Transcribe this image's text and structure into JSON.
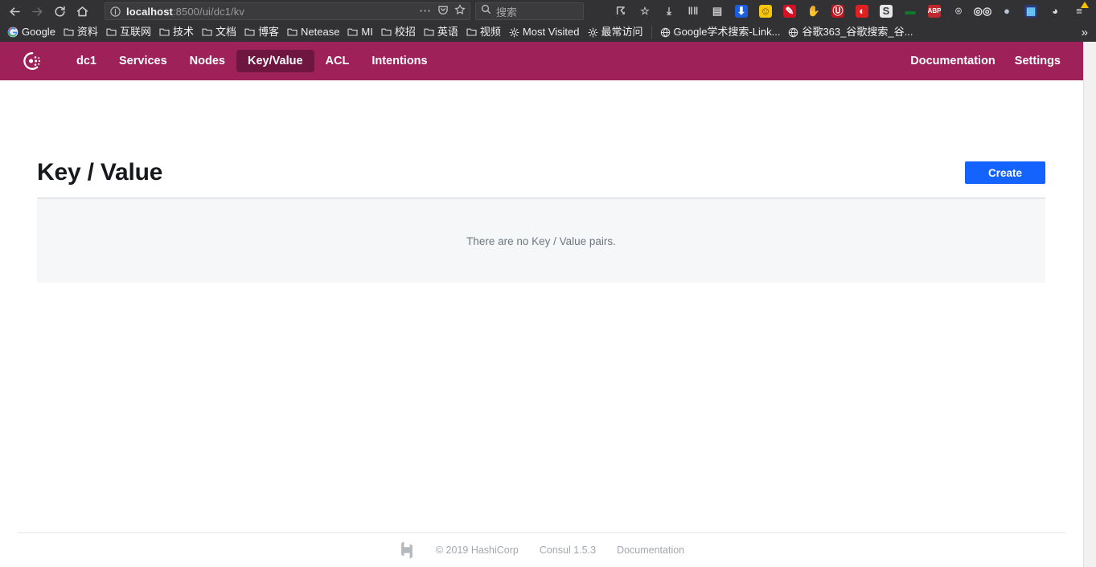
{
  "browser": {
    "nav_buttons": [
      {
        "name": "back-button",
        "icon": "arrow-left-icon",
        "enabled": true
      },
      {
        "name": "forward-button",
        "icon": "arrow-right-icon",
        "enabled": false
      },
      {
        "name": "reload-button",
        "icon": "reload-icon",
        "enabled": true
      },
      {
        "name": "home-button",
        "icon": "home-icon",
        "enabled": true
      }
    ],
    "url": {
      "host": "localhost",
      "path": ":8500/ui/dc1/kv",
      "full": "localhost:8500/ui/dc1/kv",
      "info_icon": "info-circle-icon",
      "page_actions_icon": "ellipsis-icon",
      "reader_icon": "pocket-icon",
      "bookmark_icon": "star-icon"
    },
    "search": {
      "placeholder": "搜索",
      "icon": "search-icon"
    },
    "extensions": [
      {
        "name": "pocket-save-icon",
        "glyph": "☈",
        "color": "#c9c9cb",
        "bg": "transparent"
      },
      {
        "name": "bookmark-star-icon",
        "glyph": "☆",
        "color": "#c9c9cb",
        "bg": "transparent"
      },
      {
        "name": "downloads-icon",
        "glyph": "⤓",
        "color": "#c9c9cb",
        "bg": "transparent"
      },
      {
        "name": "library-icon",
        "glyph": "‖‖",
        "color": "#c9c9cb",
        "bg": "transparent"
      },
      {
        "name": "sidebar-icon",
        "glyph": "▤",
        "color": "#c9c9cb",
        "bg": "transparent"
      },
      {
        "name": "download-manager-icon",
        "glyph": "⬇",
        "color": "#ffffff",
        "bg": "#1a5fe0"
      },
      {
        "name": "smiley-extension-icon",
        "glyph": "☺",
        "color": "#6b4a00",
        "bg": "#f5c60a"
      },
      {
        "name": "red-pen-extension-icon",
        "glyph": "✎",
        "color": "#ffffff",
        "bg": "#d41224"
      },
      {
        "name": "handshake-extension-icon",
        "glyph": "✋",
        "color": "#c96a20",
        "bg": "transparent"
      },
      {
        "name": "lastpass-extension-icon",
        "glyph": "Ⓤ",
        "color": "#ffffff",
        "bg": "#c1141d"
      },
      {
        "name": "opera-extension-icon",
        "glyph": "◐",
        "color": "#ffffff",
        "bg": "#e02020"
      },
      {
        "name": "s-extension-icon",
        "glyph": "S",
        "color": "#3c3c3c",
        "bg": "#e8e8e8"
      },
      {
        "name": "green-dash-extension-icon",
        "glyph": "▬",
        "color": "#0f7a2e",
        "bg": "transparent"
      },
      {
        "name": "adblock-plus-icon",
        "glyph": "ABP",
        "color": "#ffffff",
        "bg": "#c1272d"
      },
      {
        "name": "at-extension-icon",
        "glyph": "⌾",
        "color": "#cacacc",
        "bg": "transparent"
      },
      {
        "name": "goggles-extension-icon",
        "glyph": "◎◎",
        "color": "#e6e6e8",
        "bg": "transparent"
      },
      {
        "name": "grey-circle-extension-icon",
        "glyph": "●",
        "color": "#b9c6d6",
        "bg": "transparent"
      },
      {
        "name": "colorful-grid-extension-icon",
        "glyph": "▦",
        "color": "#6cd0ff",
        "bg": "#2b3a7a"
      },
      {
        "name": "account-icon",
        "glyph": "◕",
        "color": "#dcdcde",
        "bg": "transparent"
      },
      {
        "name": "menu-hamburger-icon",
        "glyph": "≡",
        "color": "#e4e4e6",
        "bg": "transparent",
        "badge": "warning"
      }
    ],
    "bookmarks": [
      {
        "label": "Google",
        "icon": "google-icon"
      },
      {
        "label": "资料",
        "icon": "folder-icon"
      },
      {
        "label": "互联网",
        "icon": "folder-icon"
      },
      {
        "label": "技术",
        "icon": "folder-icon"
      },
      {
        "label": "文档",
        "icon": "folder-icon"
      },
      {
        "label": "博客",
        "icon": "folder-icon"
      },
      {
        "label": "Netease",
        "icon": "folder-icon"
      },
      {
        "label": "MI",
        "icon": "folder-icon"
      },
      {
        "label": "校招",
        "icon": "folder-icon"
      },
      {
        "label": "英语",
        "icon": "folder-icon"
      },
      {
        "label": "视频",
        "icon": "folder-icon"
      },
      {
        "label": "Most Visited",
        "icon": "gear-icon"
      },
      {
        "label": "最常访问",
        "icon": "gear-icon"
      },
      {
        "label": "Google学术搜索-Link...",
        "icon": "globe-icon"
      },
      {
        "label": "谷歌363_谷歌搜索_谷...",
        "icon": "globe-icon"
      }
    ],
    "bookmarks_overflow": "»"
  },
  "consul": {
    "logo_name": "consul-logo",
    "nav_left": [
      {
        "label": "dc1",
        "active": false,
        "name": "nav-datacenter"
      },
      {
        "label": "Services",
        "active": false,
        "name": "nav-services"
      },
      {
        "label": "Nodes",
        "active": false,
        "name": "nav-nodes"
      },
      {
        "label": "Key/Value",
        "active": true,
        "name": "nav-key-value"
      },
      {
        "label": "ACL",
        "active": false,
        "name": "nav-acl"
      },
      {
        "label": "Intentions",
        "active": false,
        "name": "nav-intentions"
      }
    ],
    "nav_right": [
      {
        "label": "Documentation",
        "name": "nav-documentation"
      },
      {
        "label": "Settings",
        "name": "nav-settings"
      }
    ],
    "nav_bg": "#9e2159",
    "nav_active_bg": "#6e1540"
  },
  "main": {
    "title": "Key / Value",
    "create_button": "Create",
    "create_button_color": "#1563ff",
    "empty_message": "There are no Key / Value pairs."
  },
  "footer": {
    "logo_name": "hashicorp-logo",
    "copyright": "© 2019 HashiCorp",
    "version": "Consul 1.5.3",
    "documentation": "Documentation"
  }
}
